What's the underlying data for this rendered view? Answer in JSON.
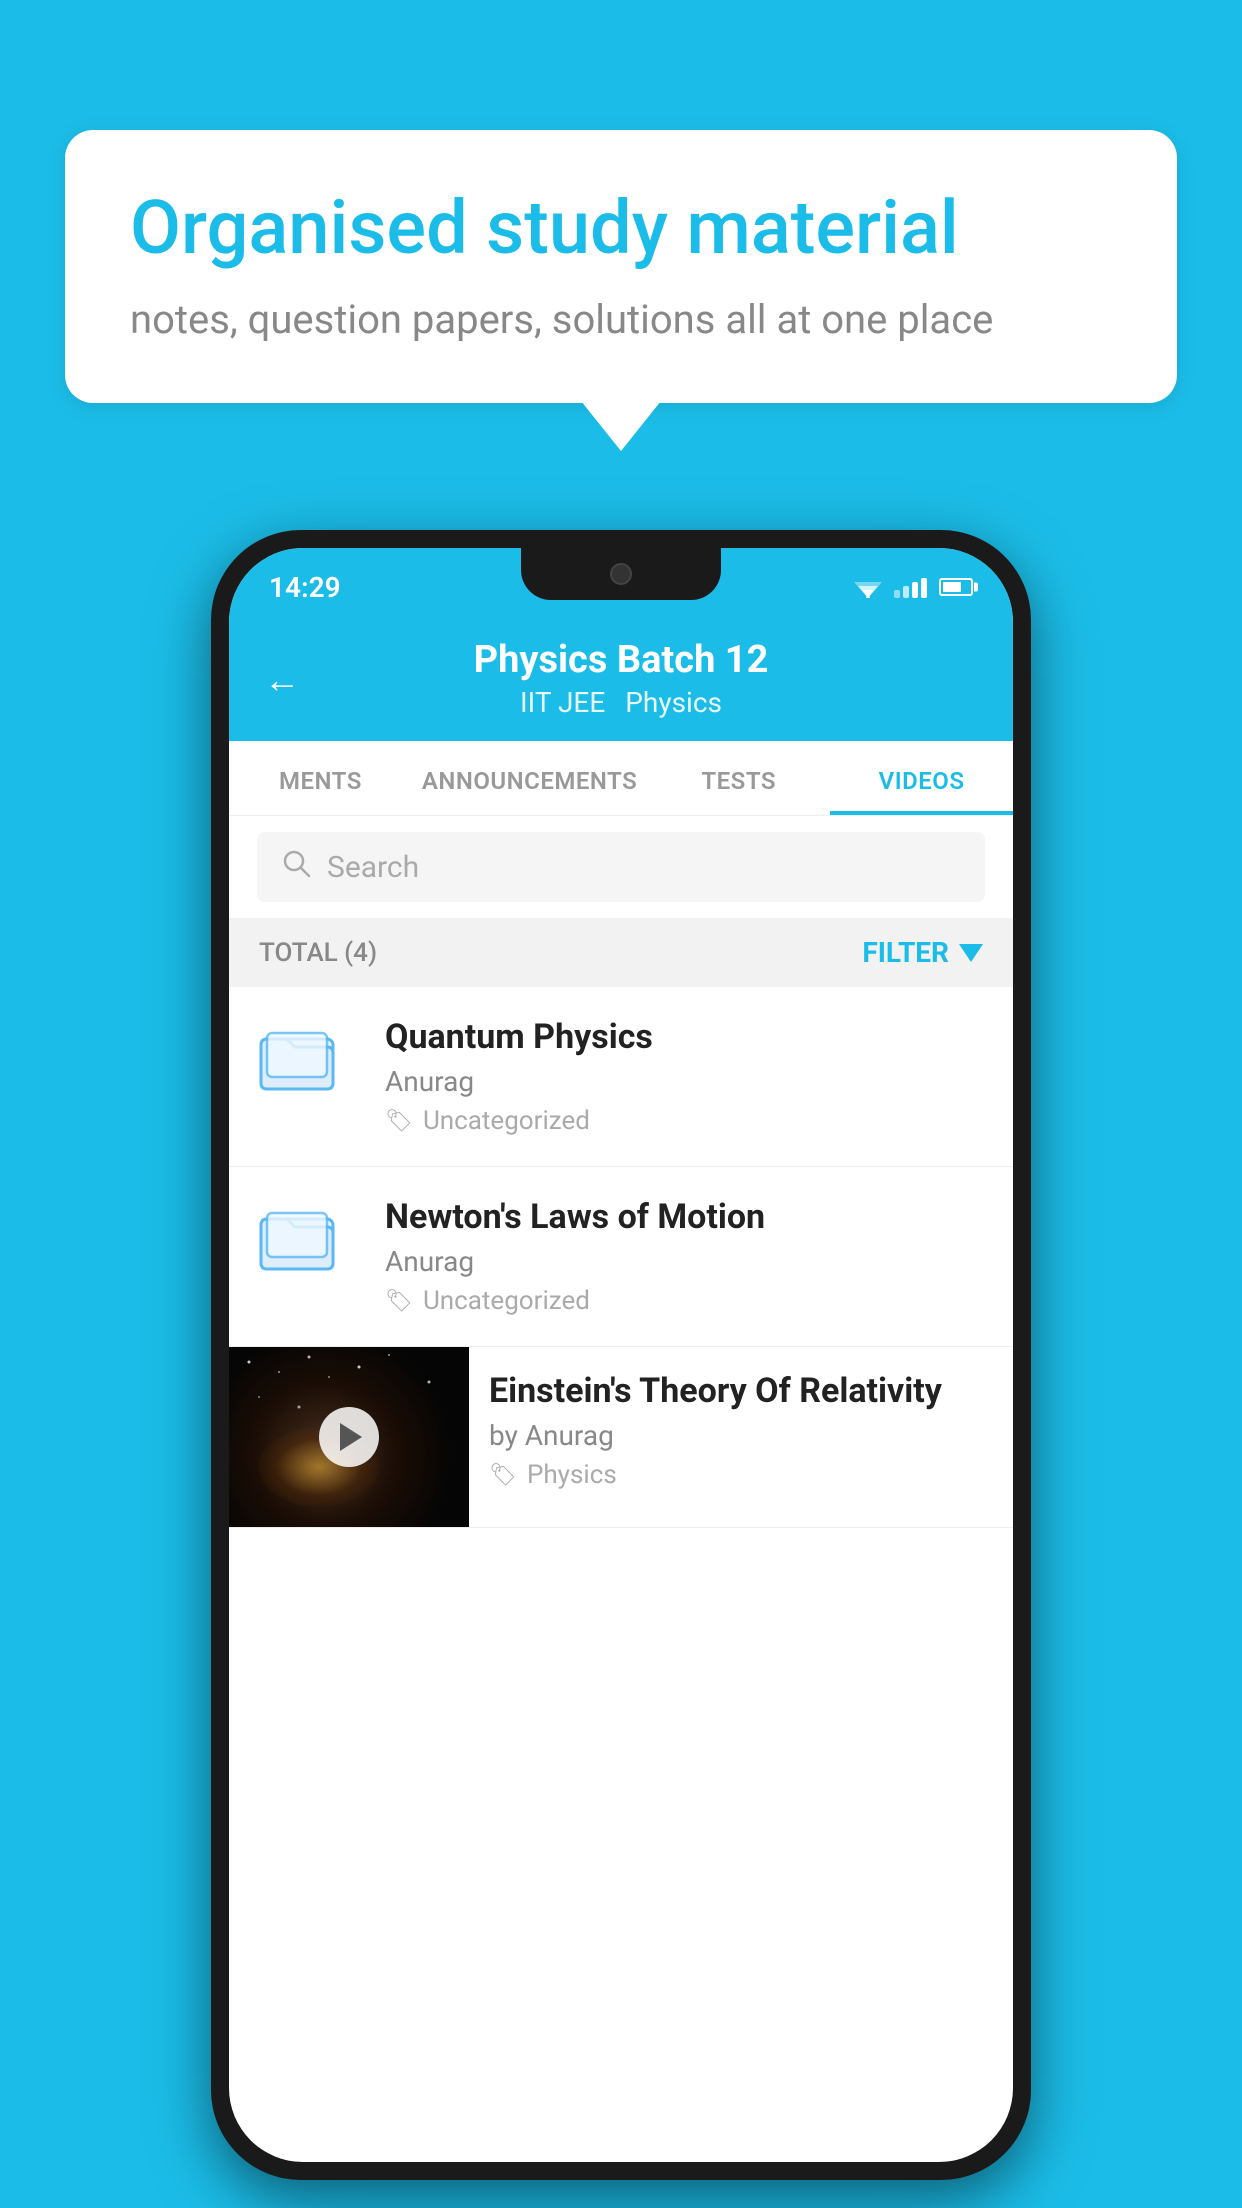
{
  "background_color": "#1bbde8",
  "speech_bubble": {
    "title": "Organised study material",
    "subtitle": "notes, question papers, solutions all at one place"
  },
  "phone": {
    "status_bar": {
      "time": "14:29",
      "wifi": "▼▲",
      "battery_level": "60%"
    },
    "header": {
      "title": "Physics Batch 12",
      "tag1": "IIT JEE",
      "tag2": "Physics",
      "back_label": "←"
    },
    "tabs": [
      {
        "label": "MENTS",
        "active": false
      },
      {
        "label": "ANNOUNCEMENTS",
        "active": false
      },
      {
        "label": "TESTS",
        "active": false
      },
      {
        "label": "VIDEOS",
        "active": true
      }
    ],
    "search": {
      "placeholder": "Search"
    },
    "filter_bar": {
      "total": "TOTAL (4)",
      "filter_label": "FILTER"
    },
    "videos": [
      {
        "title": "Quantum Physics",
        "author": "Anurag",
        "tag": "Uncategorized",
        "has_thumbnail": false
      },
      {
        "title": "Newton's Laws of Motion",
        "author": "Anurag",
        "tag": "Uncategorized",
        "has_thumbnail": false
      },
      {
        "title": "Einstein's Theory Of Relativity",
        "author": "by Anurag",
        "tag": "Physics",
        "has_thumbnail": true
      }
    ]
  }
}
